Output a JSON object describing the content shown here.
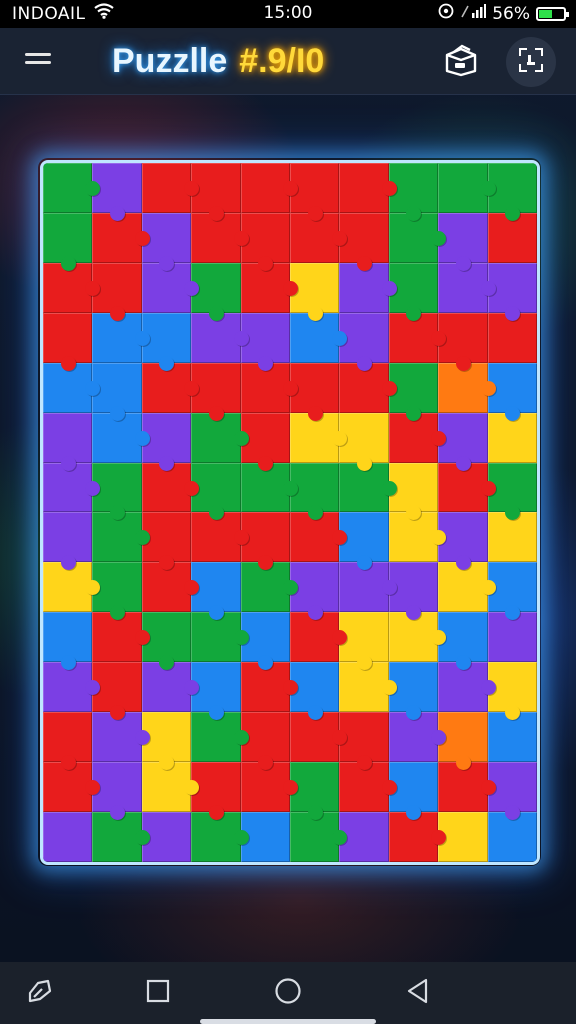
{
  "status_bar": {
    "carrier": "INDOAIL",
    "time": "15:00",
    "battery": "56%",
    "battery_level": 0.56,
    "icons": [
      "wifi-icon",
      "cast-icon",
      "signal-icon",
      "battery-icon"
    ]
  },
  "header": {
    "title_word": "Puzzlle",
    "title_number": "#.9/I0",
    "icons": [
      "hamburger-menu-icon",
      "open-box-icon",
      "grid-hint-icon"
    ]
  },
  "colors": {
    "red": "#e81d1d",
    "green": "#12a83c",
    "blue": "#1f86f0",
    "purple": "#7b3fe4",
    "yellow": "#ffd51a",
    "orange": "#ff7a12",
    "title_glow": "#3aa8ff",
    "board_border": "#bfe6ff",
    "accent_number": "#ffd93a"
  },
  "puzzle": {
    "columns": 10,
    "rows": 14,
    "grid": [
      "GPRRRRRGGG",
      "GRPRRRRGPR",
      "RRPGRYPGPP",
      "RBBPPBPRRR",
      "BBRRRRRGOB",
      "PBPGRYYRPY",
      "PGRGGGGYRG",
      "PGRRRRBYPY",
      "YGRBGPPPYB",
      "BRGGBRYYBP",
      "PRPBRBYBPY",
      "RPYGRRRPOB",
      "RPYRRGRBRP",
      "PGPGBGPRYB"
    ]
  },
  "nav_bar": {
    "icons": [
      "recent-apps-icon",
      "square-icon",
      "home-circle-icon",
      "back-triangle-icon"
    ]
  }
}
